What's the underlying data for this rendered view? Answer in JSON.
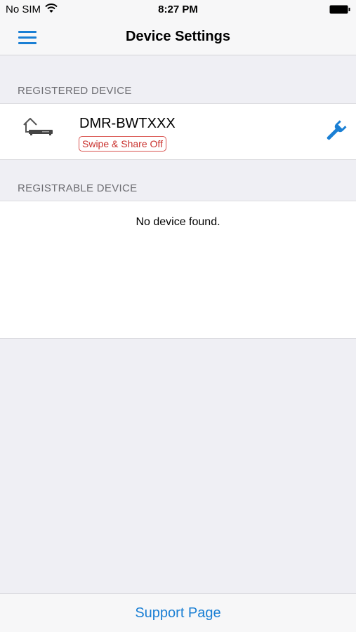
{
  "status_bar": {
    "carrier": "No SIM",
    "time": "8:27 PM"
  },
  "nav": {
    "title": "Device Settings",
    "menu_icon": "hamburger-menu-icon"
  },
  "registered": {
    "header": "REGISTERED DEVICE",
    "device": {
      "name": "DMR-BWTXXX",
      "status": "Swipe & Share Off",
      "icon": "home-recorder-icon",
      "action_icon": "wrench-icon"
    }
  },
  "registrable": {
    "header": "REGISTRABLE DEVICE",
    "empty_message": "No device found."
  },
  "footer": {
    "support_label": "Support Page"
  },
  "colors": {
    "accent": "#1a7fd4",
    "status_red": "#c9302c",
    "background": "#efeff4"
  }
}
